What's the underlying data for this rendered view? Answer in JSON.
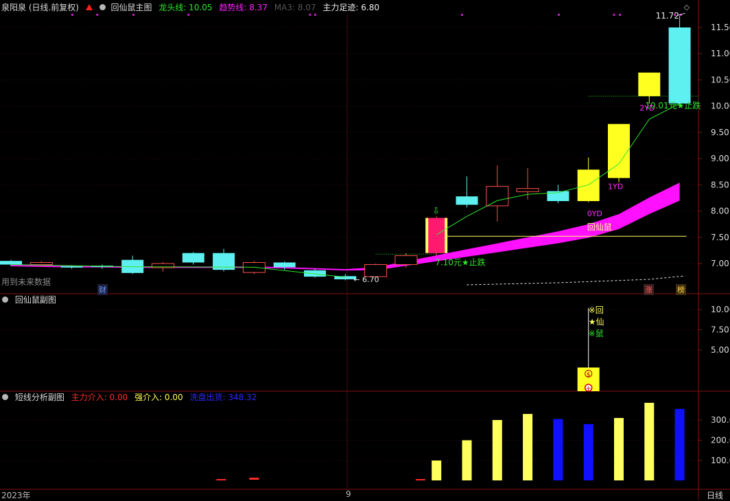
{
  "main_panel": {
    "stock_title": "泉阳泉 (日线.前复权)",
    "indicator_name": "回仙鼠主图",
    "legend": [
      {
        "label": "龙头线: 10.05",
        "color": "#2ee82e"
      },
      {
        "label": "趋势线: 8.37",
        "color": "#ff22ff"
      },
      {
        "label": "MA3: 8.07",
        "color": "#555555"
      },
      {
        "label": "主力足迹: 6.80",
        "color": "#ffffff"
      }
    ],
    "y_ticks": [
      "11.50",
      "11.00",
      "10.50",
      "10.00",
      "9.50",
      "9.00",
      "8.50",
      "8.00",
      "7.50",
      "7.00"
    ],
    "side_note": "用到未来数据",
    "marker_cai": "财",
    "marker_zhang": "涨",
    "marker_bang": "榜"
  },
  "sub1_panel": {
    "title": "回仙鼠副图",
    "y_ticks": [
      "10.00",
      "7.50",
      "5.00"
    ]
  },
  "sub2_panel": {
    "title": "短线分析副图",
    "legend": [
      {
        "label": "主力介入: 0.00",
        "color": "#ff2b2b"
      },
      {
        "label": "强介入: 0.00",
        "color": "#ffff55"
      },
      {
        "label": "洗盘出货: 348.32",
        "color": "#2a2aff"
      }
    ],
    "y_ticks": [
      "300.0",
      "200.0",
      "100.0"
    ]
  },
  "x_axis": {
    "labels": [
      "2023年",
      "9"
    ],
    "period": "日线"
  },
  "chart_data": [
    {
      "type": "candlestick",
      "title": "回仙鼠主图",
      "ylim": [
        6.6,
        11.9
      ],
      "candles": [
        {
          "o": 7.05,
          "c": 6.98,
          "h": 7.07,
          "l": 6.95
        },
        {
          "o": 6.98,
          "c": 7.02,
          "h": 7.05,
          "l": 6.94
        },
        {
          "o": 6.95,
          "c": 6.93,
          "h": 6.97,
          "l": 6.9
        },
        {
          "o": 6.96,
          "c": 6.94,
          "h": 6.98,
          "l": 6.9
        },
        {
          "o": 7.07,
          "c": 6.82,
          "h": 7.15,
          "l": 6.8
        },
        {
          "o": 6.92,
          "c": 7.0,
          "h": 7.03,
          "l": 6.85
        },
        {
          "o": 7.2,
          "c": 7.02,
          "h": 7.22,
          "l": 6.98
        },
        {
          "o": 7.2,
          "c": 6.88,
          "h": 7.28,
          "l": 6.85
        },
        {
          "o": 6.83,
          "c": 7.02,
          "h": 7.05,
          "l": 6.8
        },
        {
          "o": 7.02,
          "c": 6.93,
          "h": 7.04,
          "l": 6.88
        },
        {
          "o": 6.87,
          "c": 6.75,
          "h": 6.9,
          "l": 6.73
        },
        {
          "o": 6.76,
          "c": 6.7,
          "h": 6.8,
          "l": 6.68
        },
        {
          "o": 6.75,
          "c": 6.98,
          "h": 7.0,
          "l": 6.72
        },
        {
          "o": 6.98,
          "c": 7.15,
          "h": 7.2,
          "l": 6.92
        },
        {
          "o": 7.2,
          "c": 7.87,
          "h": 7.9,
          "l": 7.15
        },
        {
          "o": 8.28,
          "c": 8.12,
          "h": 8.66,
          "l": 8.07
        },
        {
          "o": 8.1,
          "c": 8.47,
          "h": 8.87,
          "l": 7.8
        },
        {
          "o": 8.37,
          "c": 8.43,
          "h": 8.82,
          "l": 8.22
        },
        {
          "o": 8.38,
          "c": 8.19,
          "h": 8.5,
          "l": 8.15
        },
        {
          "o": 8.19,
          "c": 8.79,
          "h": 9.02,
          "l": 8.17
        },
        {
          "o": 8.63,
          "c": 9.66,
          "h": 9.66,
          "l": 8.55
        },
        {
          "o": 10.19,
          "c": 10.64,
          "h": 10.64,
          "l": 10.05
        },
        {
          "o": 11.5,
          "c": 10.05,
          "h": 11.72,
          "l": 10.03
        }
      ],
      "series": [
        {
          "name": "龙头线",
          "values": [
            null,
            null,
            null,
            null,
            null,
            null,
            null,
            null,
            null,
            null,
            null,
            null,
            null,
            null,
            7.55,
            7.9,
            8.2,
            8.32,
            8.35,
            8.5,
            8.9,
            9.75,
            10.05
          ]
        },
        {
          "name": "趋势线",
          "values": [
            6.96,
            6.95,
            6.94,
            6.94,
            6.93,
            6.93,
            6.93,
            6.93,
            6.93,
            6.92,
            6.9,
            6.88,
            6.9,
            7.0,
            7.1,
            7.2,
            7.3,
            7.4,
            7.5,
            7.62,
            7.8,
            8.1,
            8.37
          ]
        },
        {
          "name": "主力足迹",
          "values": [
            6.8
          ]
        }
      ],
      "annotations": [
        "11.72",
        "6.70",
        "7.10元★止跌",
        "10.01元★止跌",
        "0YD",
        "1YD",
        "2YD",
        "回仙鼠"
      ],
      "level_lines": [
        7.52,
        10.19
      ]
    },
    {
      "type": "bar",
      "title": "回仙鼠副图",
      "ylim": [
        0,
        11
      ],
      "signals": [
        "※回",
        "★仙",
        "※鼠"
      ],
      "values": [
        0,
        0,
        0,
        0,
        0,
        0,
        0,
        0,
        0,
        0,
        0,
        0,
        0,
        0,
        0,
        0,
        0,
        0,
        0,
        2.5,
        0,
        0,
        0
      ]
    },
    {
      "type": "bar",
      "title": "短线分析副图",
      "ylim": [
        0,
        400
      ],
      "series": [
        {
          "name": "强介入",
          "color": "#ffff60",
          "values": [
            0,
            0,
            0,
            0,
            0,
            0,
            0,
            0,
            0,
            0,
            0,
            0,
            0,
            0,
            100,
            200,
            300,
            330,
            0,
            0,
            310,
            385,
            0
          ]
        },
        {
          "name": "洗盘出货",
          "color": "#1010ff",
          "values": [
            0,
            0,
            0,
            0,
            0,
            0,
            0,
            0,
            0,
            0,
            0,
            0,
            0,
            0,
            0,
            0,
            0,
            0,
            305,
            280,
            0,
            0,
            355
          ]
        },
        {
          "name": "主力介入",
          "color": "#ff2b2b",
          "values": [
            0,
            0,
            0,
            0,
            0,
            0,
            0,
            0,
            1.5,
            0,
            0,
            0,
            0,
            0,
            0,
            0,
            0,
            0,
            0,
            0,
            0,
            0,
            0
          ]
        }
      ]
    }
  ]
}
